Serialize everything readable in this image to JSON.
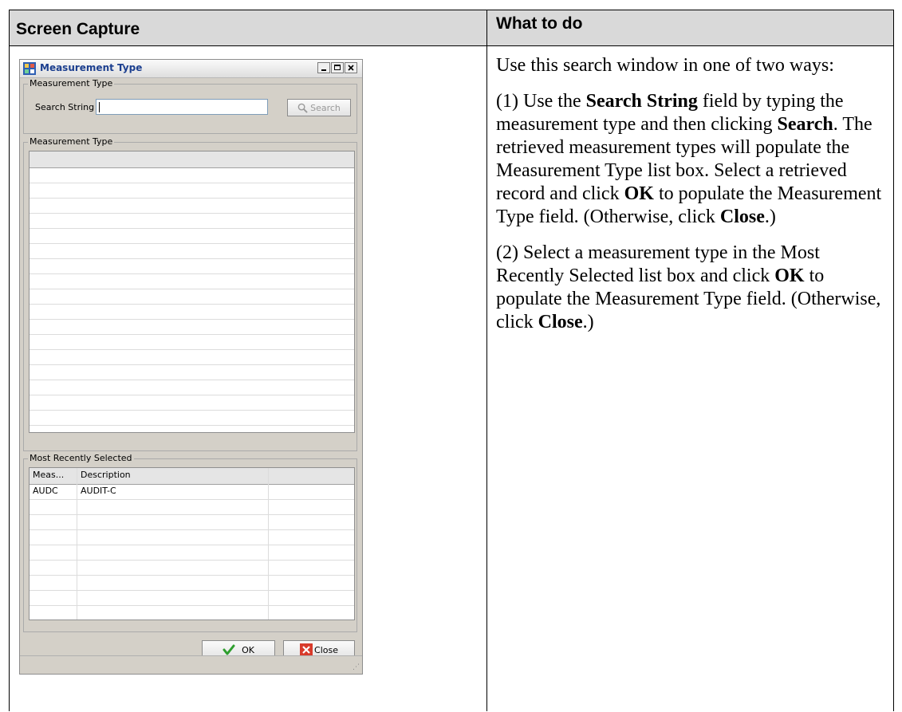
{
  "table": {
    "col1_header": "Screen Capture",
    "col2_header": "What to do"
  },
  "instructions": {
    "intro": "Use this search window in one of two ways:",
    "way1_prefix": "(1) Use the ",
    "way1_bold1": "Search String",
    "way1_mid1": " field by typing the measurement type and then clicking ",
    "way1_bold2": "Search",
    "way1_mid2": ". The retrieved measurement types will populate the Measurement Type list box. Select a retrieved record and click ",
    "way1_bold3": "OK",
    "way1_mid3": " to populate the Measurement Type field. (Otherwise, click ",
    "way1_bold4": "Close",
    "way1_end": ".)",
    "way2_prefix": "(2) Select a measurement type in the Most Recently Selected list box and click ",
    "way2_bold1": "OK",
    "way2_mid1": " to populate the Measurement Type field. (Otherwise, click ",
    "way2_bold2": "Close",
    "way2_end": ".)"
  },
  "dialog": {
    "title": "Measurement Type",
    "search_group_label": "Measurement Type",
    "search_label": "Search String",
    "search_value": "",
    "search_button": "Search",
    "results_group_label": "Measurement Type",
    "recent_group_label": "Most Recently Selected",
    "recent_columns": [
      "Meas...",
      "Description"
    ],
    "recent_rows": [
      {
        "code": "AUDC",
        "description": "AUDIT-C"
      }
    ],
    "ok_button": "OK",
    "close_button": "Close"
  },
  "colors": {
    "header_bg": "#d9d9d9",
    "dialog_bg": "#d4d0c8",
    "title_text": "#1c3f8f"
  },
  "icons": {
    "app": "app-window-icon",
    "search": "magnifier-icon",
    "ok": "green-checkmark-icon",
    "close": "red-x-icon"
  }
}
